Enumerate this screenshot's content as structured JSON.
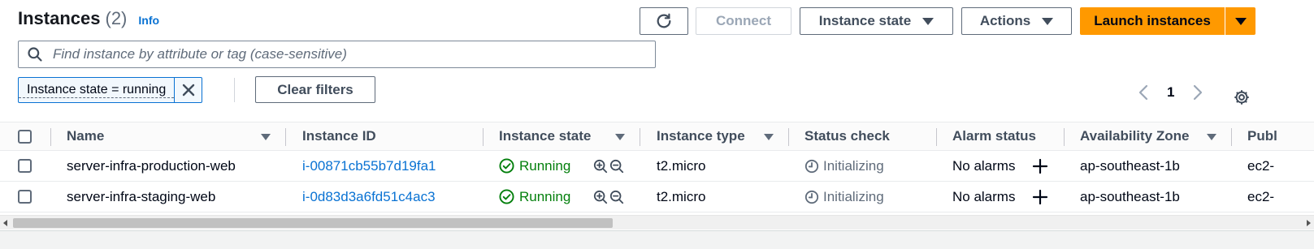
{
  "header": {
    "title": "Instances",
    "count": "(2)",
    "info_label": "Info"
  },
  "toolbar": {
    "connect_label": "Connect",
    "instance_state_label": "Instance state",
    "actions_label": "Actions",
    "launch_label": "Launch instances"
  },
  "search": {
    "placeholder": "Find instance by attribute or tag (case-sensitive)"
  },
  "filters": {
    "token_label": "Instance state = running",
    "clear_label": "Clear filters"
  },
  "pagination": {
    "current_page": "1"
  },
  "table": {
    "columns": [
      "Name",
      "Instance ID",
      "Instance state",
      "Instance type",
      "Status check",
      "Alarm status",
      "Availability Zone",
      "Publ"
    ],
    "rows": [
      {
        "name": "server-infra-production-web",
        "instance_id": "i-00871cb55b7d19fa1",
        "state": "Running",
        "type": "t2.micro",
        "status_check": "Initializing",
        "alarm_status": "No alarms",
        "az": "ap-southeast-1b",
        "public": "ec2-"
      },
      {
        "name": "server-infra-staging-web",
        "instance_id": "i-0d83d3a6fd51c4ac3",
        "state": "Running",
        "type": "t2.micro",
        "status_check": "Initializing",
        "alarm_status": "No alarms",
        "az": "ap-southeast-1b",
        "public": "ec2-"
      }
    ]
  },
  "colors": {
    "primary": "#ff9900",
    "link": "#0972d3",
    "success": "#037f0c"
  }
}
